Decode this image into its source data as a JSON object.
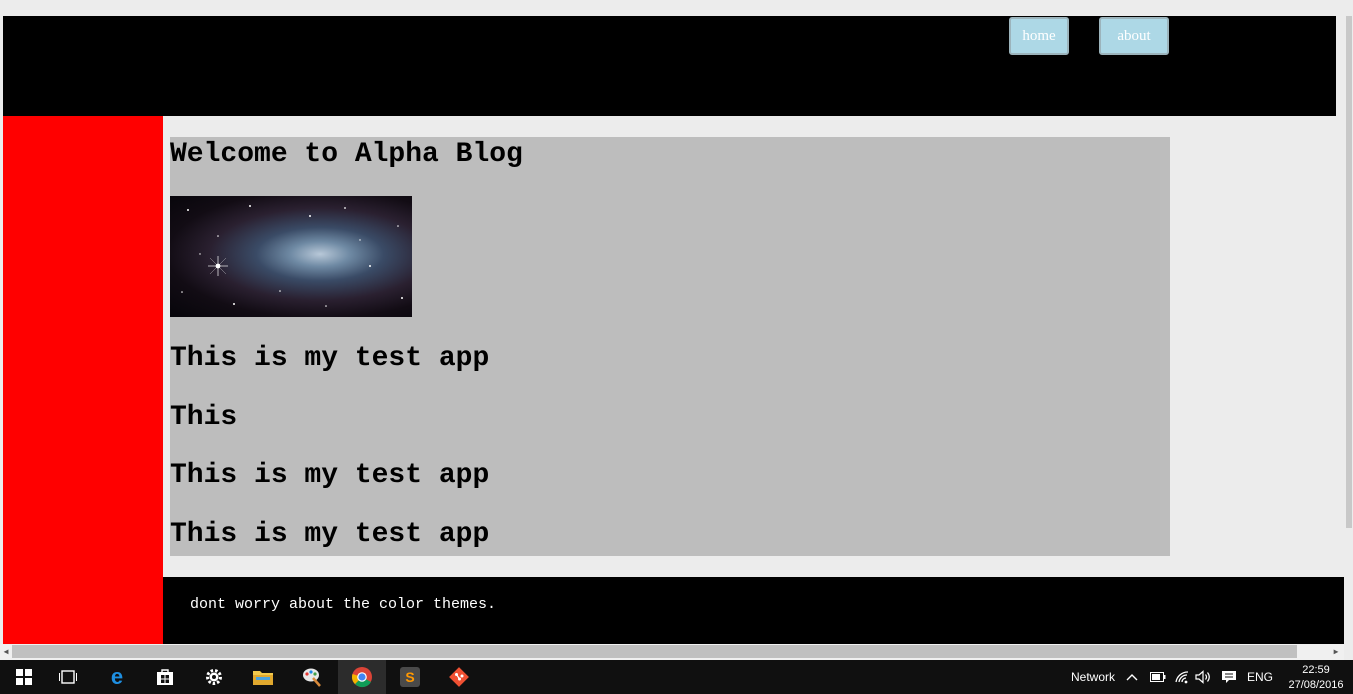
{
  "nav": {
    "home_label": "home",
    "about_label": "about"
  },
  "main": {
    "title": "Welcome to Alpha Blog",
    "lines": [
      "This is my test app",
      "This",
      "This is my test app",
      "This is my test app"
    ]
  },
  "footer": {
    "text": "dont worry about the color themes."
  },
  "colors": {
    "header": "#000000",
    "sidebar": "#ff0000",
    "content": "#bdbdbd",
    "nav_button": "#add8e6"
  },
  "taskbar": {
    "icons": [
      "windows-start-icon",
      "task-view-icon",
      "edge-icon",
      "store-icon",
      "settings-icon",
      "file-explorer-icon",
      "paint-icon",
      "chrome-icon",
      "sublime-text-icon",
      "git-icon"
    ],
    "tray": {
      "network_label": "Network",
      "language": "ENG",
      "time": "22:59",
      "date": "27/08/2016"
    }
  }
}
